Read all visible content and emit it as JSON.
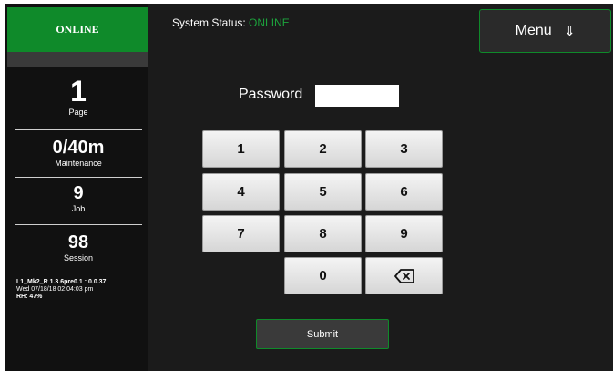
{
  "sidebar": {
    "status": "ONLINE",
    "stats": [
      {
        "value": "1",
        "label": "Page"
      },
      {
        "value": "0/40m",
        "label": "Maintenance"
      },
      {
        "value": "9",
        "label": "Job"
      },
      {
        "value": "98",
        "label": "Session"
      }
    ],
    "version_line": "L1_Mk2_R 1.3.6pre0.1 : 0.0.37",
    "datetime_line": "Wed 07/18/18 02:04:03 pm",
    "rh_line": "RH: 47%"
  },
  "header": {
    "system_status_label": "System Status:",
    "system_status_value": "ONLINE",
    "menu_label": "Menu",
    "menu_icon": "⇓"
  },
  "login": {
    "password_label": "Password",
    "password_value": "",
    "keys": [
      "1",
      "2",
      "3",
      "4",
      "5",
      "6",
      "7",
      "8",
      "9",
      "0"
    ],
    "backspace_icon": "backspace-icon",
    "submit_label": "Submit"
  },
  "colors": {
    "background": "#1b1b1b",
    "sidebar": "#111111",
    "accent_green": "#0f8a2a",
    "status_green": "#1ca33c"
  }
}
